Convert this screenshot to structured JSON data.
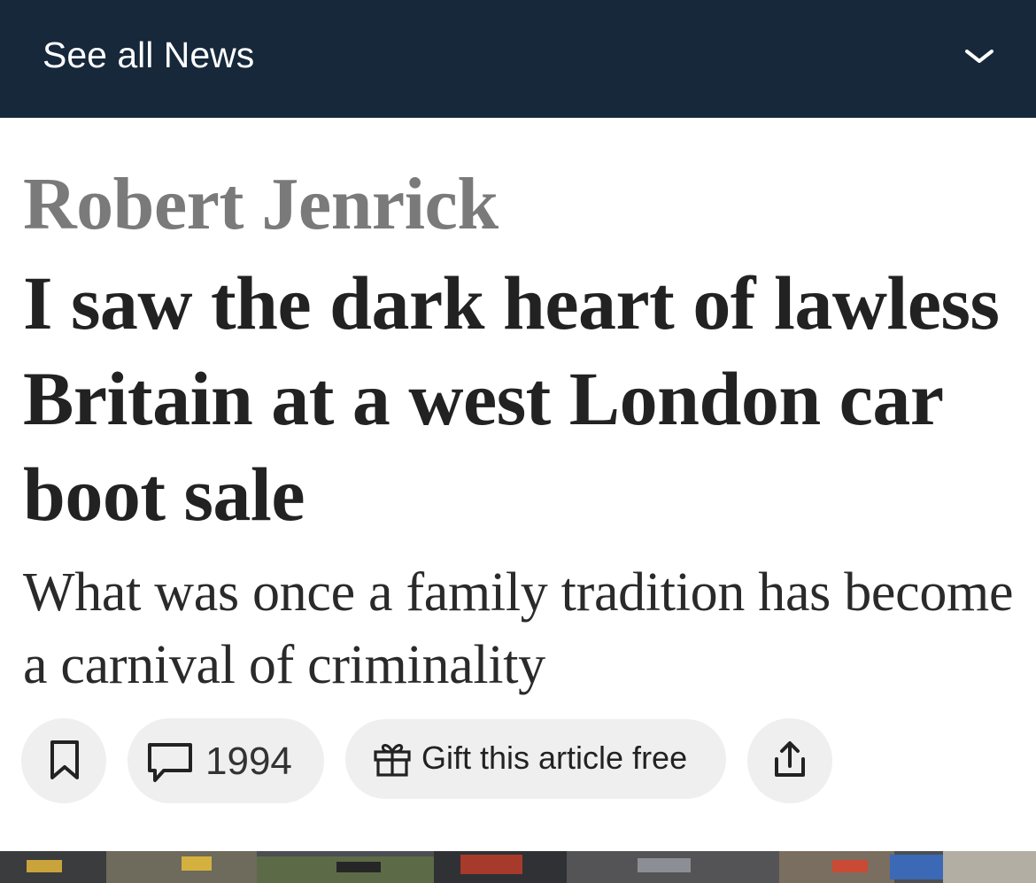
{
  "nav": {
    "label": "See all News",
    "chevron_icon": "chevron-down-icon"
  },
  "article": {
    "author": "Robert Jenrick",
    "headline": "I saw the dark heart of lawless Britain at a west London car boot sale",
    "standfirst": "What was once a family tradition has become a carnival of criminality"
  },
  "actions": {
    "bookmark_icon": "bookmark-icon",
    "comment_icon": "comment-icon",
    "comment_count": "1994",
    "gift_icon": "gift-icon",
    "gift_label": "Gift this article free",
    "share_icon": "share-icon"
  },
  "colors": {
    "nav_background": "#16283a",
    "author": "#7a7a7a",
    "headline": "#222222",
    "pill_background": "#efefef"
  }
}
